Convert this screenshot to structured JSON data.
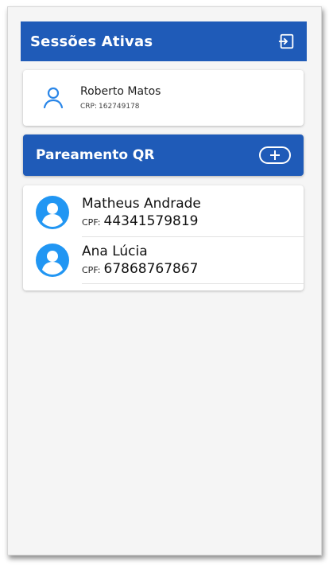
{
  "header": {
    "title": "Sessões Ativas",
    "exit_icon": "logout-icon"
  },
  "session": {
    "name": "Roberto Matos",
    "crp_label": "CRP:",
    "crp_value": "162749178",
    "icon": "user-outline-icon"
  },
  "qr_section": {
    "title": "Pareamento QR",
    "add_icon": "plus-circle-icon"
  },
  "people": [
    {
      "name": "Matheus Andrade",
      "cpf_label": "CPF:",
      "cpf_value": "44341579819"
    },
    {
      "name": "Ana Lúcia",
      "cpf_label": "CPF:",
      "cpf_value": "67868767867"
    }
  ],
  "colors": {
    "primary": "#1f5bb8",
    "avatar": "#2196f3",
    "background": "#f5f5f5"
  }
}
